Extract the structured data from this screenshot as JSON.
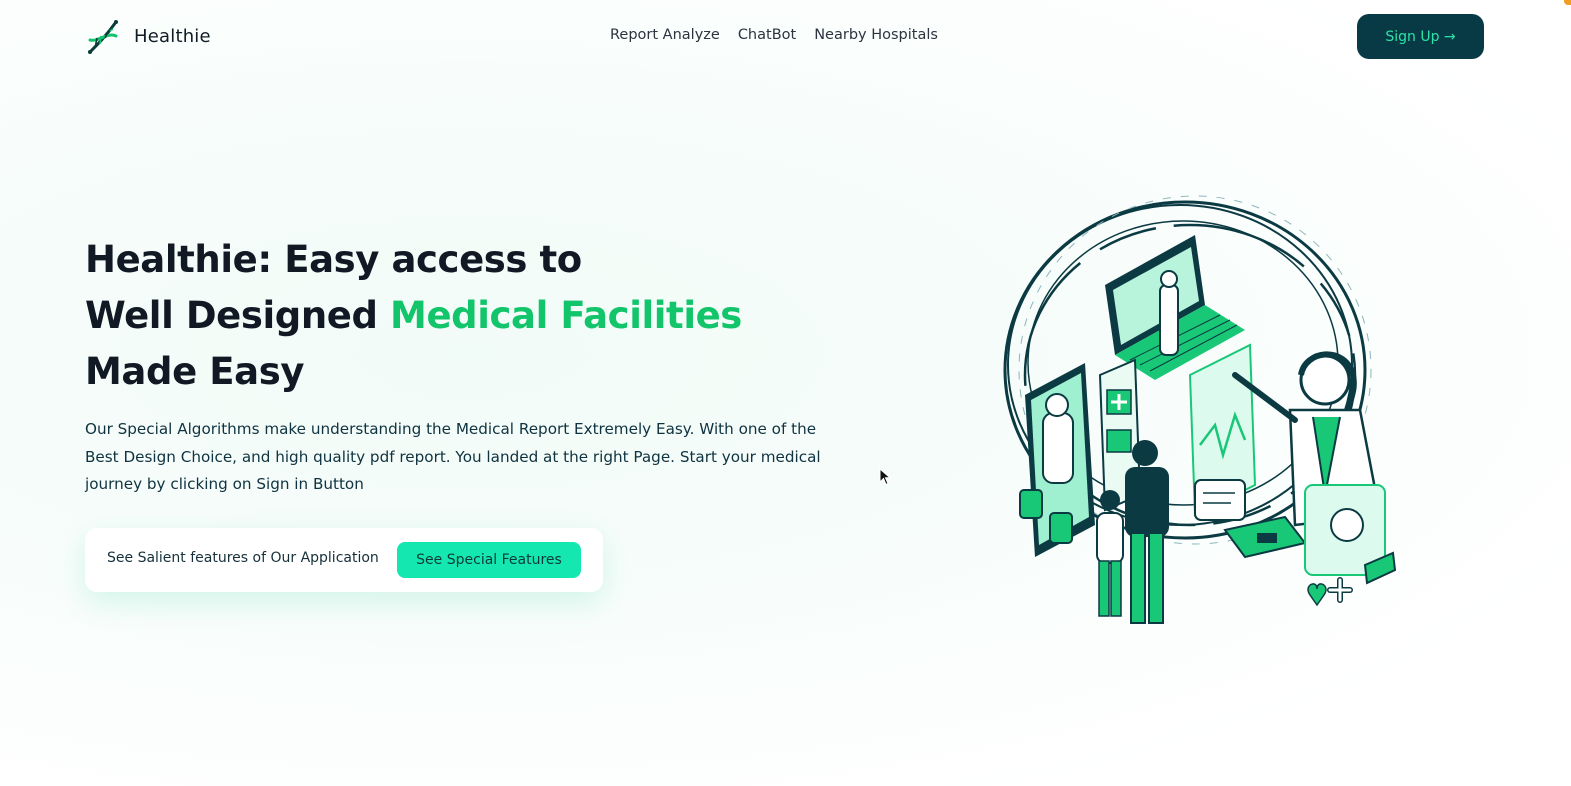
{
  "nav": {
    "brand": "Healthie",
    "links": [
      "Report Analyze",
      "ChatBot",
      "Nearby Hospitals"
    ],
    "signup_label": "Sign Up →",
    "logo_icon": "dna-icon"
  },
  "hero": {
    "title_line1": "Healthie: Easy access to",
    "title_line2_prefix": "Well Designed ",
    "title_line2_accent": "Medical Facilities",
    "title_line3": "Made Easy",
    "description": "Our Special Algorithms make understanding the Medical Report Extremely Easy. With one of the Best Design Choice, and high quality pdf report. You landed at the right Page. Start your medical journey by clicking on Sign in Button",
    "cta_text": "See Salient features of Our Application",
    "cta_button": "See Special Features"
  },
  "colors": {
    "primary_dark": "#083a46",
    "accent_green": "#12c46a",
    "cta_button": "#14e8b0",
    "signup_text": "#2ee3a8"
  }
}
